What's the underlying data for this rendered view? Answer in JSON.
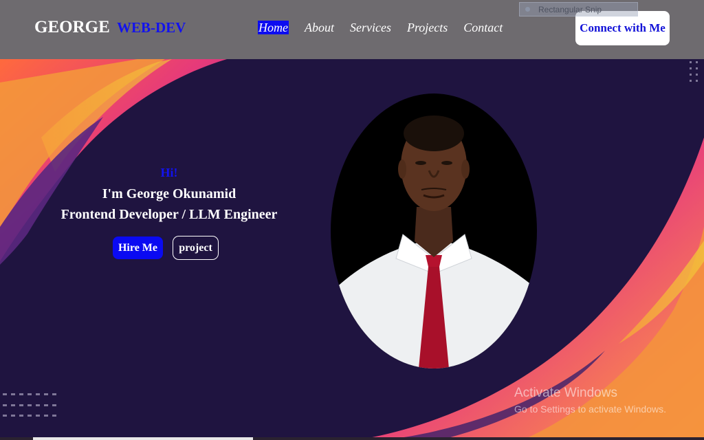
{
  "navbar": {
    "brand_name": "GEORGE",
    "brand_accent": "WEB-DEV",
    "links": [
      {
        "label": "Home",
        "active": true
      },
      {
        "label": "About",
        "active": false
      },
      {
        "label": "Services",
        "active": false
      },
      {
        "label": "Projects",
        "active": false
      },
      {
        "label": "Contact",
        "active": false
      }
    ],
    "cta_label": "Connect with Me"
  },
  "overlay": {
    "snip_label": "Rectangular Snip"
  },
  "hero": {
    "greeting": "Hi!",
    "name_line": "I'm George Okunamid",
    "role_line": "Frontend Developer / LLM Engineer",
    "hire_label": "Hire Me",
    "project_label": "project"
  },
  "watermark": {
    "title": "Activate Windows",
    "subtitle": "Go to Settings to activate Windows."
  },
  "colors": {
    "accent": "#0c0cf0",
    "navbar_bg": "#6e6b6f",
    "hero_bg": "#1f1440"
  },
  "icons": {
    "portrait": "person-photo",
    "snip": "snip-tool-icon"
  }
}
